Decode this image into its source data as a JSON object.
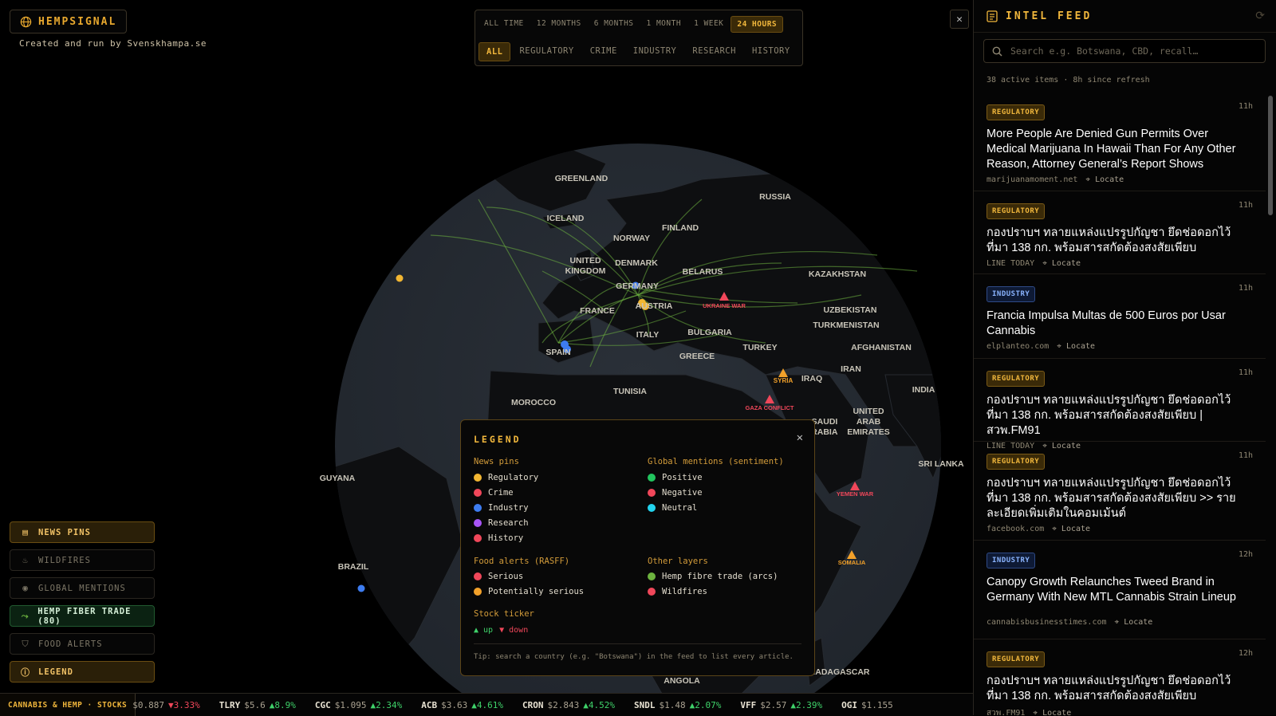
{
  "brand": {
    "name": "HEMPSIGNAL",
    "credit": "Created and run by Svenskhampa.se"
  },
  "filters": {
    "time": [
      "ALL TIME",
      "12 MONTHS",
      "6 MONTHS",
      "1 MONTH",
      "1 WEEK",
      "24 HOURS"
    ],
    "time_selected": "24 HOURS",
    "category": [
      "ALL",
      "REGULATORY",
      "CRIME",
      "INDUSTRY",
      "RESEARCH",
      "HISTORY"
    ],
    "category_selected": "ALL"
  },
  "close_glyph": "✕",
  "map_labels": [
    "GREENLAND",
    "RUSSIA",
    "ICELAND",
    "FINLAND",
    "NORWAY",
    "UNITED",
    "KINGDOM",
    "DENMARK",
    "BELARUS",
    "KAZAKHSTAN",
    "GERMANY",
    "AUSTRIA",
    "FRANCE",
    "UZBEKISTAN",
    "TURKMENISTAN",
    "BULGARIA",
    "ITALY",
    "SPAIN",
    "TURKEY",
    "AFGHANISTAN",
    "GREECE",
    "IRAN",
    "IRAQ",
    "SYRIA",
    "MOROCCO",
    "TUNISIA",
    "INDIA",
    "UNITED",
    "ARAB",
    "EMIRATES",
    "GUYANA",
    "SRI LANKA",
    "BRAZIL",
    "ANGOLA",
    "MADAGASCAR",
    "SAUDI",
    "ARABIA"
  ],
  "conflicts": [
    "UKRAINE WAR",
    "GAZA CONFLICT",
    "YEMEN WAR",
    "SOMALIA"
  ],
  "layers": [
    {
      "label": "NEWS PINS",
      "icon": "newspaper-icon",
      "state": "active"
    },
    {
      "label": "WILDFIRES",
      "icon": "flame-icon",
      "state": "off"
    },
    {
      "label": "GLOBAL MENTIONS",
      "icon": "broadcast-icon",
      "state": "off"
    },
    {
      "label": "HEMP FIBER TRADE (80)",
      "icon": "trade-route-icon",
      "state": "active-green"
    },
    {
      "label": "FOOD ALERTS",
      "icon": "shield-icon",
      "state": "off"
    },
    {
      "label": "LEGEND",
      "icon": "info-icon",
      "state": "active"
    }
  ],
  "legend": {
    "title": "LEGEND",
    "news_pins": {
      "heading": "News pins",
      "items": [
        {
          "label": "Regulatory",
          "color": "#f2b632"
        },
        {
          "label": "Crime",
          "color": "#f0475a"
        },
        {
          "label": "Industry",
          "color": "#3d7cf0"
        },
        {
          "label": "Research",
          "color": "#a855f7"
        },
        {
          "label": "History",
          "color": "#f0475a"
        }
      ]
    },
    "mentions": {
      "heading": "Global mentions (sentiment)",
      "items": [
        {
          "label": "Positive",
          "color": "#22c55e"
        },
        {
          "label": "Negative",
          "color": "#f0475a"
        },
        {
          "label": "Neutral",
          "color": "#22d3ee"
        }
      ]
    },
    "food": {
      "heading": "Food alerts (RASFF)",
      "items": [
        {
          "label": "Serious",
          "color": "#f0475a"
        },
        {
          "label": "Potentially serious",
          "color": "#f2a12a"
        }
      ]
    },
    "other": {
      "heading": "Other layers",
      "items": [
        {
          "label": "Hemp fibre trade (arcs)",
          "color": "#6db33f"
        },
        {
          "label": "Wildfires",
          "color": "#f0475a"
        }
      ]
    },
    "stock": {
      "heading": "Stock ticker",
      "up": "▲ up",
      "down": "▼ down"
    },
    "tip": "Tip: search a country (e.g. \"Botswana\") in the feed to list every article."
  },
  "ticker": {
    "label": "CANNABIS & HEMP · STOCKS",
    "items": [
      {
        "symbol": "",
        "price": "$0.887",
        "change": "▼3.33%",
        "dir": "down"
      },
      {
        "symbol": "TLRY",
        "price": "$5.6",
        "change": "▲8.9%",
        "dir": "up"
      },
      {
        "symbol": "CGC",
        "price": "$1.095",
        "change": "▲2.34%",
        "dir": "up"
      },
      {
        "symbol": "ACB",
        "price": "$3.63",
        "change": "▲4.61%",
        "dir": "up"
      },
      {
        "symbol": "CRON",
        "price": "$2.843",
        "change": "▲4.52%",
        "dir": "up"
      },
      {
        "symbol": "SNDL",
        "price": "$1.48",
        "change": "▲2.07%",
        "dir": "up"
      },
      {
        "symbol": "VFF",
        "price": "$2.57",
        "change": "▲2.39%",
        "dir": "up"
      },
      {
        "symbol": "OGI",
        "price": "$1.155",
        "change": "",
        "dir": "up"
      }
    ]
  },
  "feed": {
    "title": "INTEL FEED",
    "search_placeholder": "Search e.g. Botswana, CBD, recall…",
    "meta": "38 active items · 8h since refresh",
    "locate": "Locate",
    "items": [
      {
        "tag": "REGULATORY",
        "kind": "reg",
        "age": "11h",
        "title": "More People Are Denied Gun Permits Over Medical Marijuana In Hawaii Than For Any Other Reason, Attorney General’s Report Shows",
        "source": "marijuanamoment.net"
      },
      {
        "tag": "REGULATORY",
        "kind": "reg",
        "age": "11h",
        "title": "กองปราบฯ ทลายแหล่งแปรรูปกัญชา ยึดช่อดอกไว้ที่มา 138 กก. พร้อมสารสกัดต้องสงสัยเพียบ",
        "source": "LINE TODAY"
      },
      {
        "tag": "INDUSTRY",
        "kind": "ind",
        "age": "11h",
        "title": "Francia Impulsa Multas de 500 Euros por Usar Cannabis",
        "source": "elplanteo.com"
      },
      {
        "tag": "REGULATORY",
        "kind": "reg",
        "age": "11h",
        "title": "กองปราบฯ ทลายแหล่งแปรรูปกัญชา ยึดช่อดอกไว้ที่มา 138 กก. พร้อมสารสกัดต้องสงสัยเพียบ | สวพ.FM91",
        "source": "LINE TODAY"
      },
      {
        "tag": "REGULATORY",
        "kind": "reg",
        "age": "11h",
        "title": "กองปราบฯ ทลายแหล่งแปรรูปกัญชา ยึดช่อดอกไว้ที่มา 138 กก. พร้อมสารสกัดต้องสงสัยเพียบ >> รายละเอียดเพิ่มเติมในคอมเม้นต์",
        "source": "facebook.com"
      },
      {
        "tag": "INDUSTRY",
        "kind": "ind",
        "age": "12h",
        "title": "Canopy Growth Relaunches Tweed Brand in Germany With New MTL Cannabis Strain Lineup",
        "source": "cannabisbusinesstimes.com"
      },
      {
        "tag": "REGULATORY",
        "kind": "reg",
        "age": "12h",
        "title": "กองปราบฯ ทลายแหล่งแปรรูปกัญชา ยึดช่อดอกไว้ที่มา 138 กก. พร้อมสารสกัดต้องสงสัยเพียบ",
        "source": "สวพ.FM91"
      }
    ]
  }
}
